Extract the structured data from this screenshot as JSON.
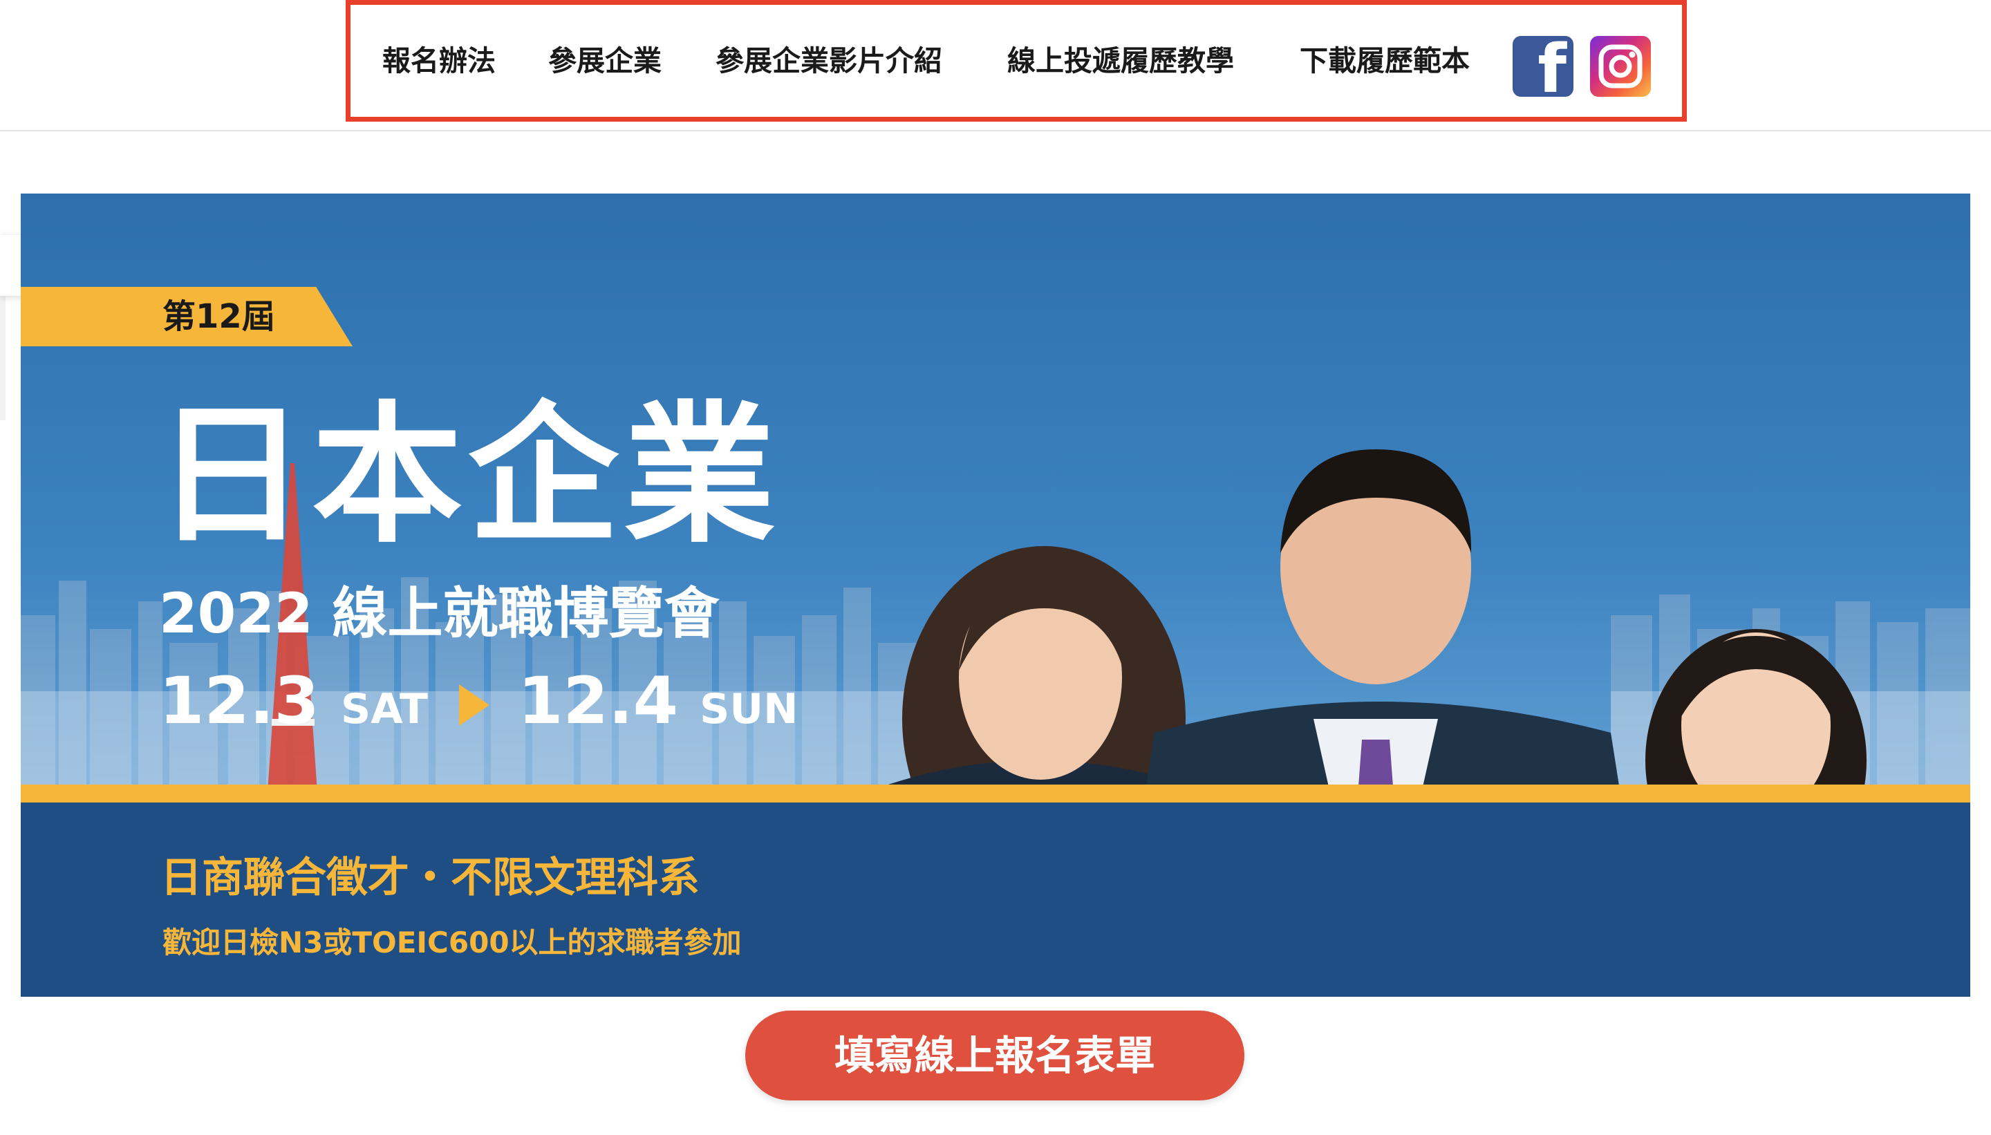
{
  "nav": {
    "items": [
      {
        "label": "報名辦法"
      },
      {
        "label": "參展企業"
      },
      {
        "label": "參展企業影片介紹"
      },
      {
        "label": "線上投遞履歷教學"
      },
      {
        "label": "下載履歷範本"
      }
    ],
    "social": [
      {
        "icon": "facebook-icon",
        "color": "#3b5998"
      },
      {
        "icon": "instagram-icon"
      }
    ],
    "highlight_color": "#e8402b"
  },
  "side_tab": {
    "icon": "gear-icon"
  },
  "banner": {
    "edition": "第12屆",
    "title": "日本企業",
    "subtitle": "2022 線上就職博覽會",
    "start_date": "12.3",
    "start_day": "SAT",
    "end_date": "12.4",
    "end_day": "SUN",
    "tagline": "日商聯合徵才・不限文理科系",
    "eligibility": "歡迎日檢N3或TOEIC600以上的求職者參加",
    "colors": {
      "accent": "#f5b63a",
      "navy": "#1f4e85",
      "sky": "#3d83c0"
    }
  },
  "cta": {
    "label": "填寫線上報名表單",
    "color": "#e0503e"
  }
}
